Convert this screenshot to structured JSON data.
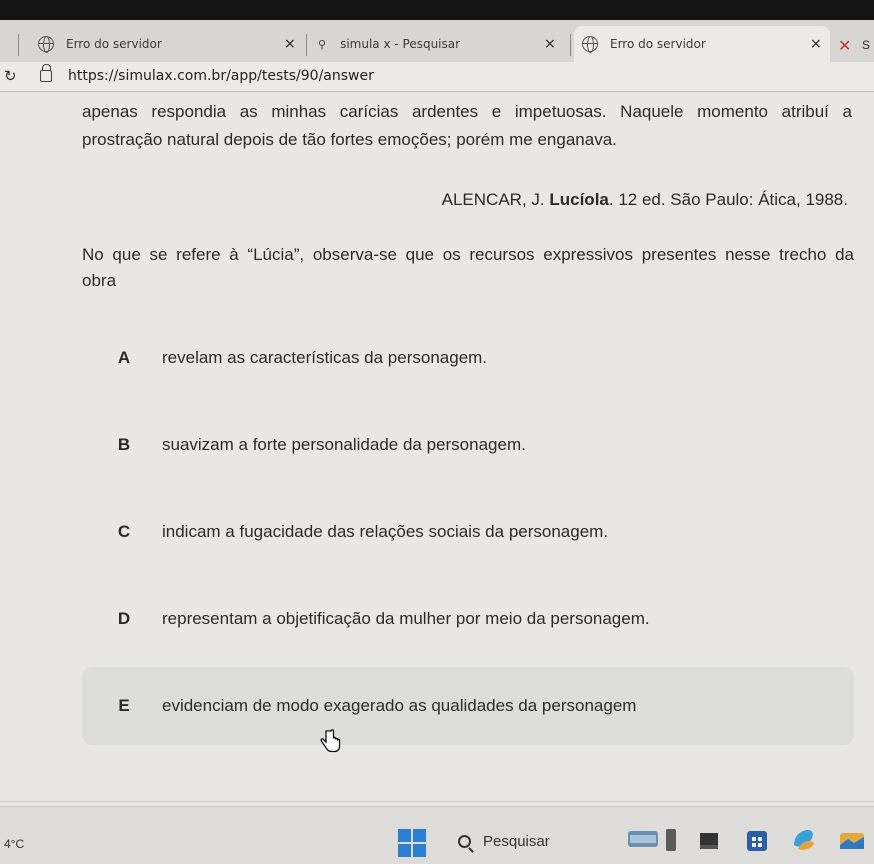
{
  "browser": {
    "tabs": [
      {
        "title": "Erro do servidor",
        "icon": "globe-icon",
        "close": "×"
      },
      {
        "title": "simula x - Pesquisar",
        "icon": "search-icon",
        "close": "×"
      },
      {
        "title": "Erro do servidor",
        "icon": "globe-icon",
        "close": "×",
        "active": true
      }
    ],
    "partial_tab_letter": "S",
    "url": "https://simulax.com.br/app/tests/90/answer"
  },
  "passage": {
    "line1": "apenas respondia as minhas carícias ardentes e impetuosas. Naquele momento atribuí a",
    "line2": "prostração natural depois de tão fortes emoções; porém me enganava."
  },
  "citation": {
    "author": "ALENCAR, J.",
    "work": "Lucíola",
    "details": ". 12 ed. São Paulo: Ática, 1988."
  },
  "question": {
    "line1": "No que se refere à “Lúcia”, observa-se que os recursos expressivos presentes nesse trecho da",
    "line2": "obra"
  },
  "options": [
    {
      "letter": "A",
      "text": "revelam as características da personagem."
    },
    {
      "letter": "B",
      "text": "suavizam a forte personalidade da personagem."
    },
    {
      "letter": "C",
      "text": "indicam a fugacidade das relações sociais da personagem."
    },
    {
      "letter": "D",
      "text": "representam a objetificação da mulher por meio da personagem."
    },
    {
      "letter": "E",
      "text": "evidenciam de modo exagerado as qualidades da personagem"
    }
  ],
  "taskbar": {
    "temperature": "4°C",
    "search_label": "Pesquisar"
  },
  "colors": {
    "accent_windows": "#2a7fd4",
    "highlight_option": "#dcdcdb"
  }
}
